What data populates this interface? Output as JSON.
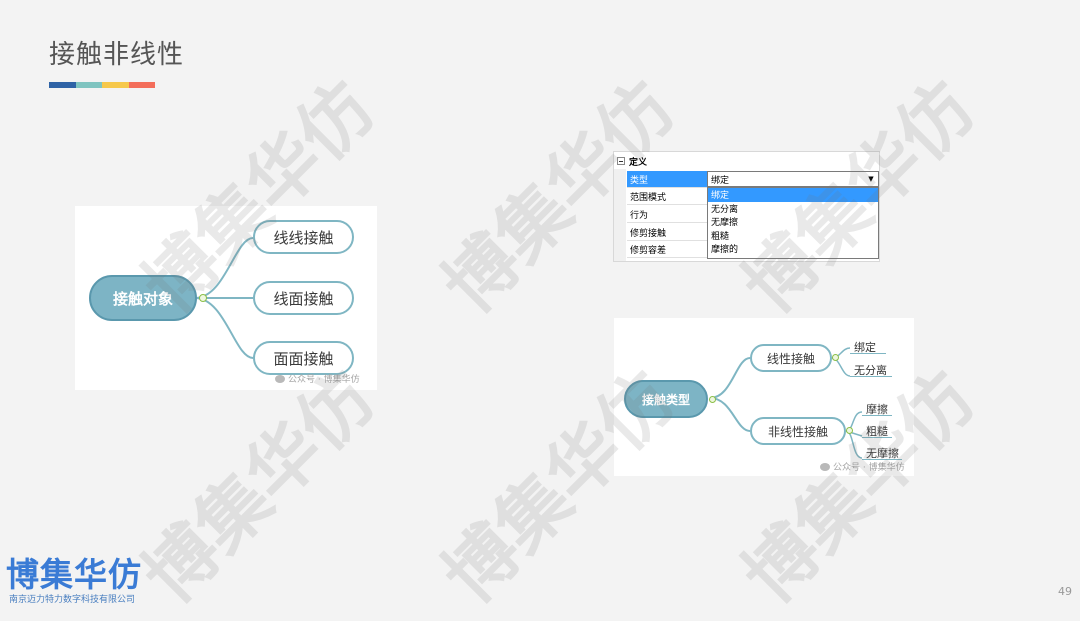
{
  "slide": {
    "title": "接触非线性",
    "title_bar_colors": [
      "#2f63a6",
      "#7fc4c0",
      "#f6c84b",
      "#f36d5a"
    ],
    "page_number": "49"
  },
  "watermark": {
    "text": "博集华仿"
  },
  "brand": {
    "logo_text": "博集华仿",
    "company": "南京迈力特力数字科技有限公司",
    "color": "#3a7bd5"
  },
  "mindmap_objects": {
    "root": "接触对象",
    "branches": [
      "线线接触",
      "线面接触",
      "面面接触"
    ],
    "source_mark": "公众号 · 博集华仿"
  },
  "property_grid": {
    "section": "定义",
    "rows": [
      "类型",
      "范围模式",
      "行为",
      "修剪接触",
      "修剪容差"
    ],
    "combo_value": "绑定",
    "options": [
      "绑定",
      "无分离",
      "无摩擦",
      "粗糙",
      "摩擦的"
    ],
    "selected_option": "绑定"
  },
  "mindmap_types": {
    "root": "接触类型",
    "branches": [
      {
        "label": "线性接触",
        "leaves": [
          "绑定",
          "无分离"
        ]
      },
      {
        "label": "非线性接触",
        "leaves": [
          "摩擦",
          "粗糙",
          "无摩擦"
        ]
      }
    ],
    "source_mark": "公众号 · 博集华仿"
  }
}
